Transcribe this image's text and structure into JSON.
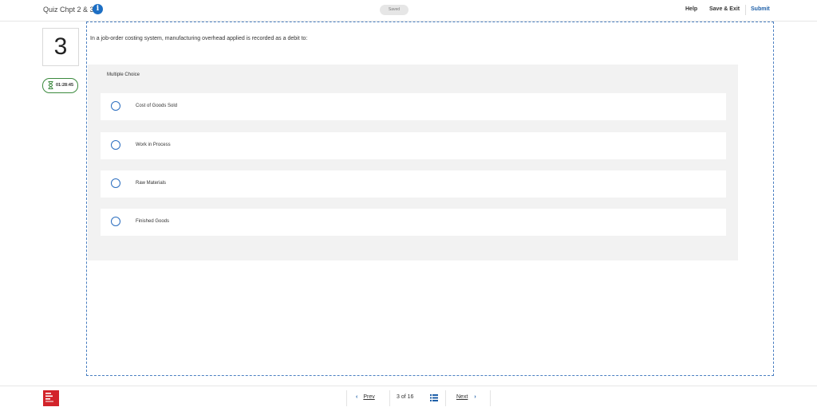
{
  "header": {
    "quiz_title": "Quiz Chpt 2 & 3",
    "info_glyph": "i",
    "saved_status": "Saved",
    "help_label": "Help",
    "save_exit_label": "Save & Exit",
    "submit_label": "Submit"
  },
  "question": {
    "number": "3",
    "timer": "01:28:45",
    "text": "In a job-order costing system, manufacturing overhead applied is recorded as a debit to:",
    "type_label": "Multiple Choice",
    "options": [
      {
        "label": "Cost of Goods Sold"
      },
      {
        "label": "Work in Process"
      },
      {
        "label": "Raw Materials"
      },
      {
        "label": "Finished Goods"
      }
    ]
  },
  "footer": {
    "logo_text": "Mc Graw Hill Education",
    "prev_label": "Prev",
    "page_indicator": "3 of 16",
    "next_label": "Next"
  },
  "colors": {
    "accent": "#1d5fa8",
    "timer_border": "#3b8a3e",
    "logo_red": "#d2232a",
    "panel_bg": "#f2f2f2"
  },
  "icons": {
    "info": "info-icon",
    "timer": "hourglass-icon",
    "radio": "radio-icon",
    "question_list": "grid-icon",
    "prev": "chevron-left-icon",
    "next": "chevron-right-icon"
  }
}
